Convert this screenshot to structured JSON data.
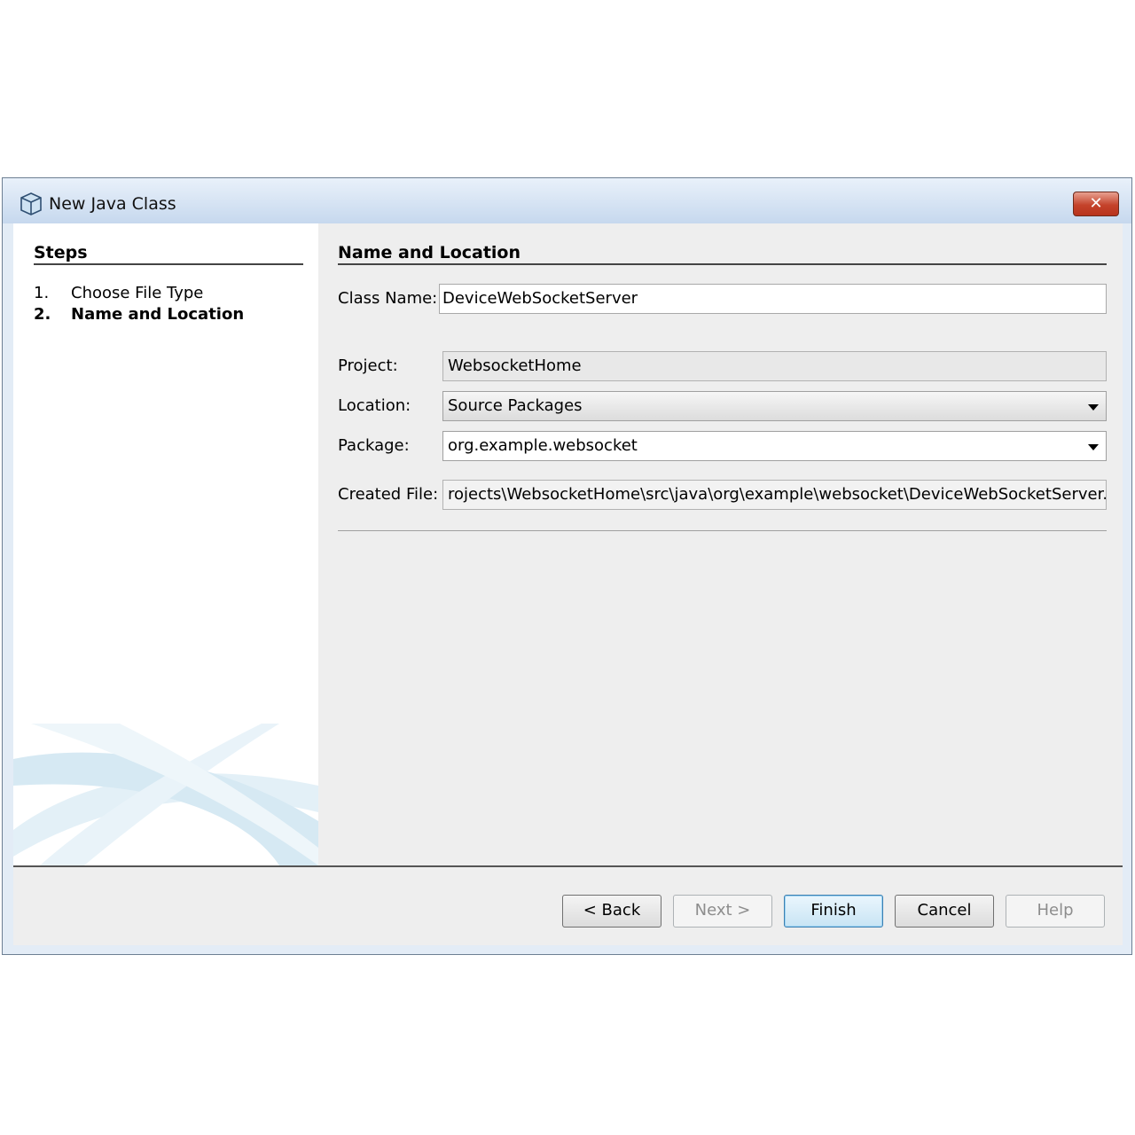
{
  "window": {
    "title": "New Java Class",
    "close_glyph": "✕"
  },
  "steps": {
    "title": "Steps",
    "items": [
      {
        "num": "1.",
        "label": "Choose File Type"
      },
      {
        "num": "2.",
        "label": "Name and Location"
      }
    ]
  },
  "form": {
    "section_title": "Name and Location",
    "class_name": {
      "label": "Class Name:",
      "value": "DeviceWebSocketServer"
    },
    "project": {
      "label": "Project:",
      "value": "WebsocketHome"
    },
    "location": {
      "label": "Location:",
      "value": "Source Packages"
    },
    "package": {
      "label": "Package:",
      "value": "org.example.websocket"
    },
    "created_file": {
      "label": "Created File:",
      "value": "rojects\\WebsocketHome\\src\\java\\org\\example\\websocket\\DeviceWebSocketServer.java"
    }
  },
  "buttons": {
    "back": "< Back",
    "next": "Next >",
    "finish": "Finish",
    "cancel": "Cancel",
    "help": "Help"
  },
  "icons": {
    "title": "java-class-cube-icon",
    "close": "close-icon",
    "dropdown": "chevron-down-icon"
  }
}
